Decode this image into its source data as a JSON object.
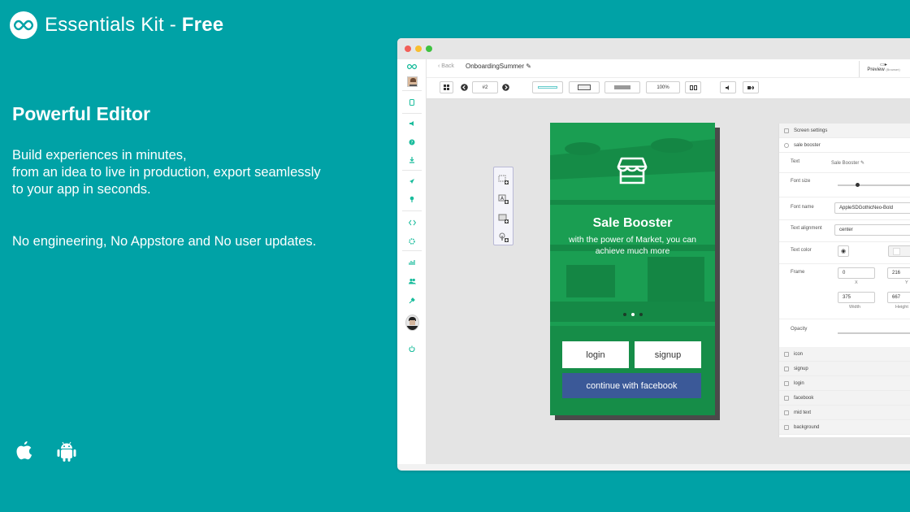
{
  "brand": {
    "name": "Essentials Kit - ",
    "plan": "Free"
  },
  "headline": "Powerful Editor",
  "description": {
    "line1": "Build experiences in minutes,",
    "line2": "from an idea to live in production, export seamlessly",
    "line3": "to your app in seconds."
  },
  "tagline": "No engineering, No Appstore and No user updates.",
  "platforms": [
    "apple-icon",
    "android-icon"
  ],
  "editor": {
    "back_label": "Back",
    "screen_name": "OnboardingSummer",
    "preview_label": "Preview",
    "preview_sub": "(Browser)",
    "toolbar": {
      "page_select": "#2",
      "zoom": "100%"
    },
    "phone": {
      "title": "Sale Booster",
      "subtitle": "with the power of Market, you can achieve much more",
      "login_label": "login",
      "signup_label": "signup",
      "facebook_label": "continue with facebook"
    },
    "panel": {
      "screen_settings": "Screen settings",
      "section": "sale booster",
      "text_label": "Text",
      "text_value": "Sale Booster",
      "font_size_label": "Font size",
      "font_name_label": "Font name",
      "font_name_value": "AppleSDGothicNeo-Bold",
      "alignment_label": "Text alignment",
      "alignment_value": "center",
      "color_label": "Text color",
      "frame_label": "Frame",
      "frame_x": "0",
      "frame_y": "216",
      "x_label": "X",
      "y_label": "Y",
      "frame_w": "375",
      "frame_h": "667",
      "width_label": "Width",
      "height_label": "Height",
      "opacity_label": "Opacity",
      "layers": [
        "icon",
        "signup",
        "login",
        "facebook",
        "mid text",
        "background"
      ]
    }
  },
  "colors": {
    "background": "#00a2a6",
    "phone": "#1a9e52",
    "facebook": "#3b5998",
    "accent": "#1abc9c"
  }
}
